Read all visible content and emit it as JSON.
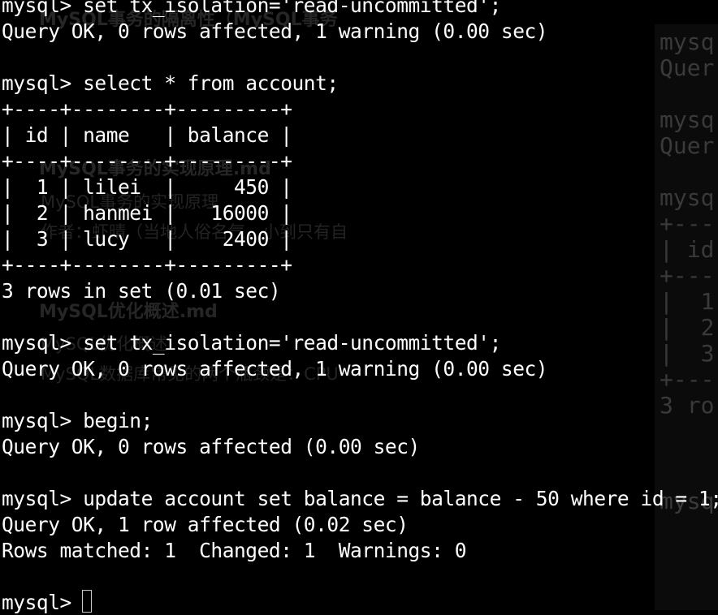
{
  "background_text": {
    "doc_title_1": "MySQL事务的隔离性（MySQL事务",
    "doc_title_2": "MySQL事务的实现原理",
    "doc_ext_2": ".md",
    "doc_subtitle_2": "MySQL事务的实现原理",
    "doc_author_2": "作者：虾晴（当地人俗名气，小到只有自",
    "doc_title_3": "MySQL优化概述",
    "doc_ext_3": ".md",
    "doc_line_3a": "MySQL优化概述",
    "doc_line_3b": "MySQL数据库常见的两个瓶颈是：CPU"
  },
  "side_terminal": {
    "lines": [
      "mysq",
      "Quer",
      "",
      "mysq",
      "Quer",
      "",
      "mysq",
      "+---",
      "| id",
      "+---",
      "|  1",
      "|  2",
      "|  3",
      "+---",
      "3 ro",
      "",
      "",
      "mysq"
    ]
  },
  "terminal": {
    "lines": [
      "mysql> set tx_isolation='read-uncommitted';",
      "Query OK, 0 rows affected, 1 warning (0.00 sec)",
      "",
      "mysql> select * from account;",
      "+----+--------+---------+",
      "| id | name   | balance |",
      "+----+--------+---------+",
      "|  1 | lilei  |     450 |",
      "|  2 | hanmei |   16000 |",
      "|  3 | lucy   |    2400 |",
      "+----+--------+---------+",
      "3 rows in set (0.01 sec)",
      "",
      "mysql> set tx_isolation='read-uncommitted';",
      "Query OK, 0 rows affected, 1 warning (0.00 sec)",
      "",
      "mysql> begin;",
      "Query OK, 0 rows affected (0.00 sec)",
      "",
      "mysql> update account set balance = balance - 50 where id = 1;",
      "Query OK, 1 row affected (0.02 sec)",
      "Rows matched: 1  Changed: 1  Warnings: 0",
      "",
      "mysql> "
    ]
  },
  "colors": {
    "background": "#000000",
    "text": "#ffffff",
    "ghost_text": "#2b2b2b",
    "side_panel": "#0b0b0b"
  }
}
